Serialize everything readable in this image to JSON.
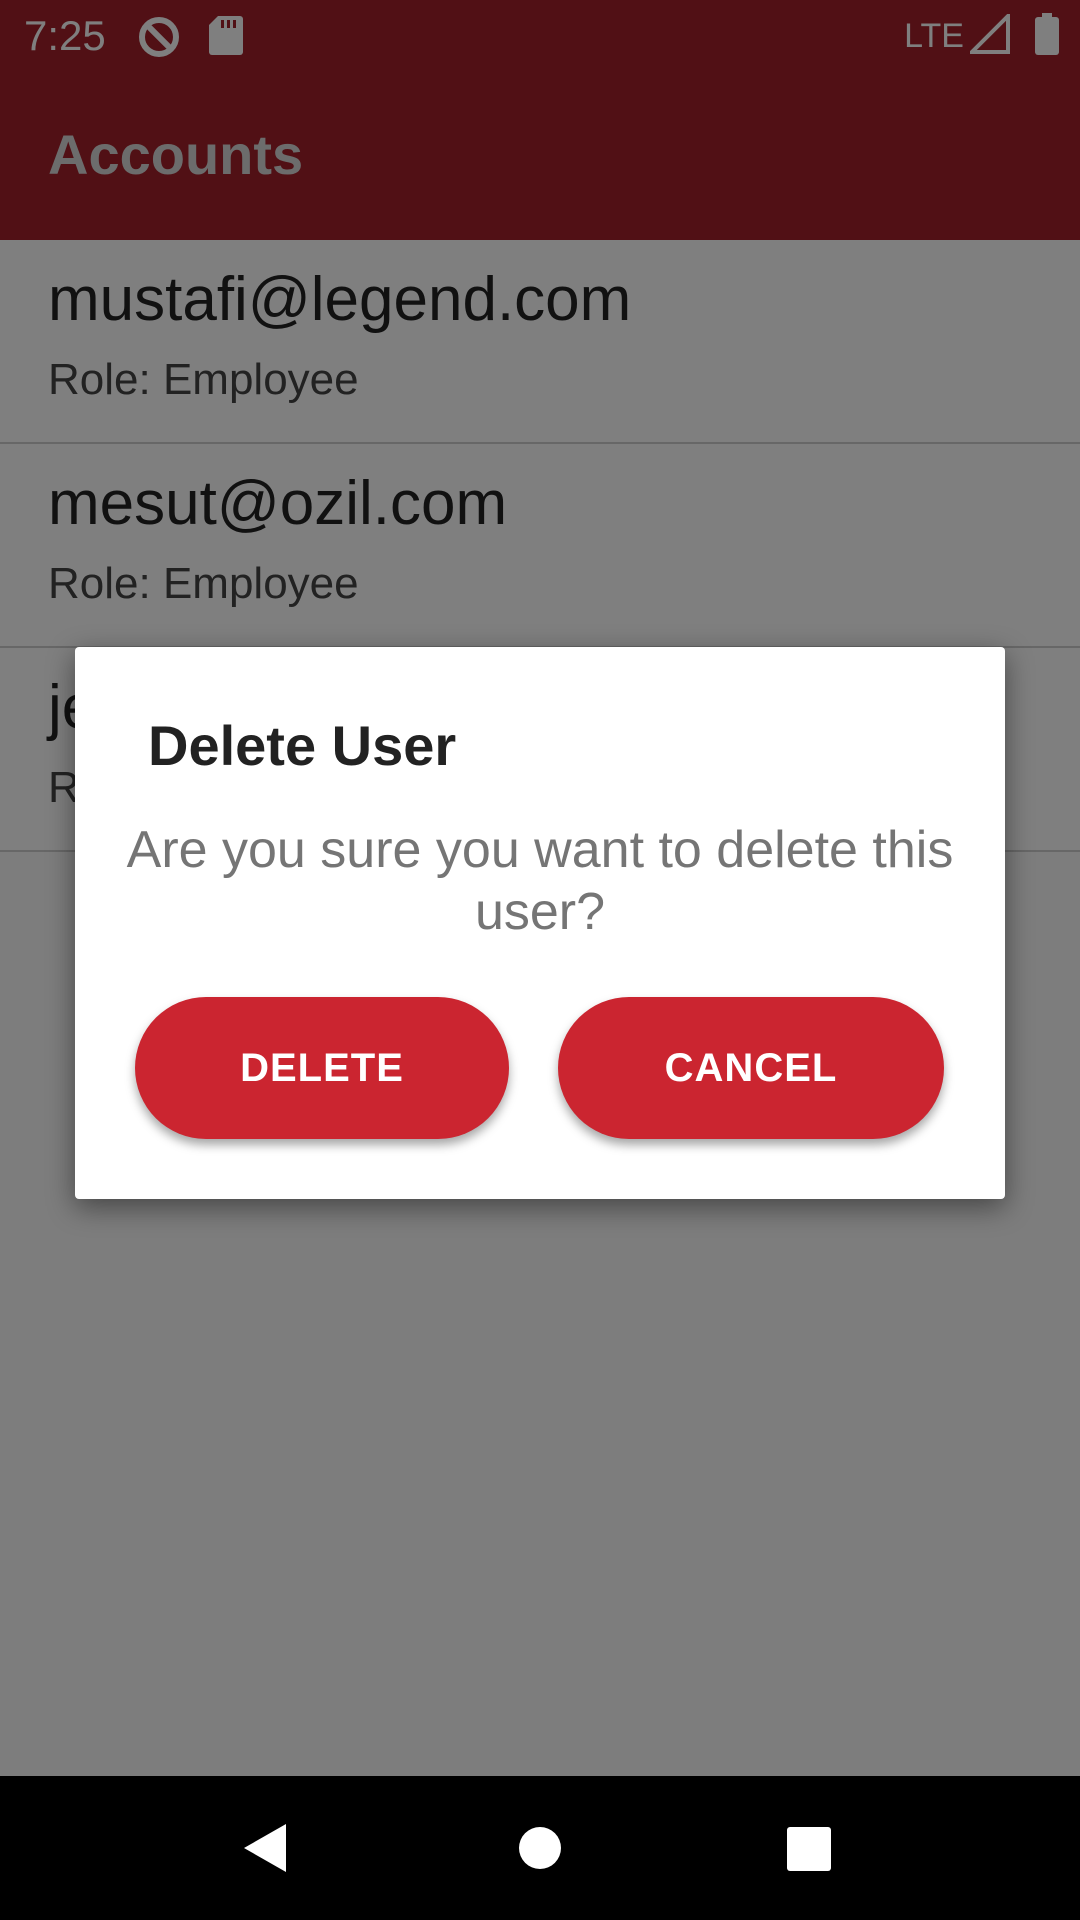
{
  "status_bar": {
    "time": "7:25",
    "network": "LTE",
    "icons": [
      "data-saver-icon",
      "sd-card-icon",
      "signal-icon",
      "battery-icon"
    ]
  },
  "app_bar": {
    "title": "Accounts"
  },
  "accounts": [
    {
      "email": "mustafi@legend.com",
      "role": "Role: Employee"
    },
    {
      "email": "mesut@ozil.com",
      "role": "Role: Employee"
    },
    {
      "email": "je",
      "role": "R"
    }
  ],
  "dialog": {
    "title": "Delete User",
    "message": "Are you sure you want to delete this user?",
    "delete_label": "DELETE",
    "cancel_label": "CANCEL"
  },
  "nav_bar": {
    "icons": [
      "back-icon",
      "home-icon",
      "recents-icon"
    ]
  },
  "colors": {
    "primary": "#a3202a",
    "button": "#cb2530"
  }
}
